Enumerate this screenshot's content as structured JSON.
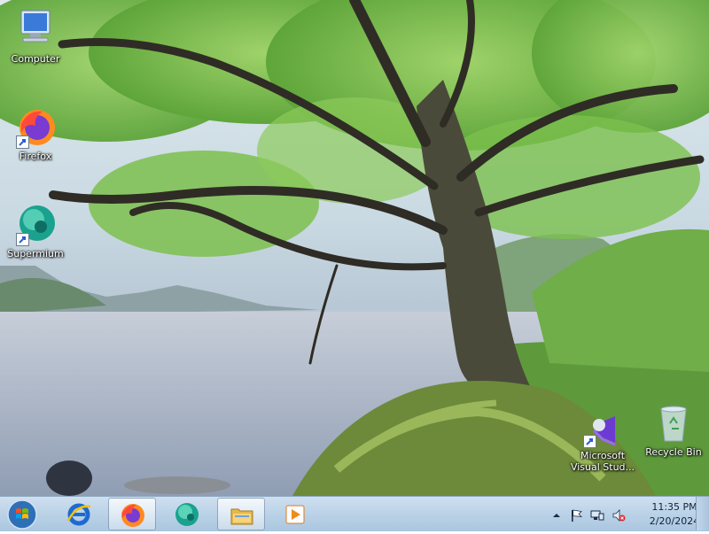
{
  "desktop": {
    "icons": [
      {
        "label": "Computer",
        "icon": "computer-icon"
      },
      {
        "label": "Firefox",
        "icon": "firefox-icon"
      },
      {
        "label": "Supermium",
        "icon": "supermium-icon"
      },
      {
        "label": "Microsoft Visual Stud...",
        "icon": "visual-studio-icon"
      },
      {
        "label": "Recycle Bin",
        "icon": "recycle-bin-icon"
      }
    ]
  },
  "taskbar": {
    "pinned": [
      {
        "icon": "internet-explorer-icon"
      },
      {
        "icon": "firefox-icon"
      },
      {
        "icon": "supermium-icon"
      },
      {
        "icon": "file-explorer-icon"
      },
      {
        "icon": "media-player-icon"
      }
    ],
    "tray": {
      "time": "11:35 PM",
      "date": "2/20/2024",
      "icons": [
        "show-hidden-icons-icon",
        "action-center-flag-icon",
        "network-icon",
        "volume-muted-icon"
      ]
    }
  },
  "colors": {
    "taskbar": "#bcd3e8",
    "label_text": "#ffffff"
  }
}
